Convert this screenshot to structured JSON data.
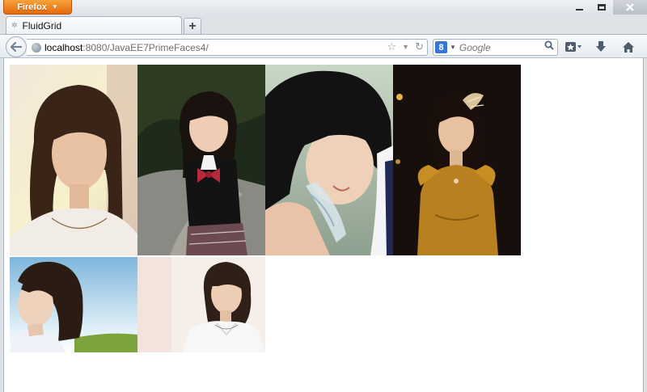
{
  "browser": {
    "menu_label": "Firefox",
    "menu_caret": "▼"
  },
  "tab": {
    "title": "FluidGrid",
    "new_tab_label": "+"
  },
  "address": {
    "host": "localhost",
    "path": ":8080/JavaEE7PrimeFaces4/"
  },
  "search": {
    "engine": "8",
    "placeholder": "Google"
  },
  "icons": {
    "back": "back-arrow-icon",
    "site": "globe-icon",
    "bookmark_star": "star-icon",
    "dropdown": "chevron-down-icon",
    "reload": "reload-icon",
    "search_go": "magnifier-icon",
    "bookmarks_menu": "bookmarks-icon",
    "downloads": "download-arrow-icon",
    "home": "home-icon"
  },
  "colors": {
    "firefox_button": "#e66a0c",
    "page_background": "#ffffff"
  },
  "gallery": {
    "images": [
      {
        "name": "woman-portrait-light-background"
      },
      {
        "name": "girl-school-uniform-red-bow"
      },
      {
        "name": "girl-smiling-drinking-water"
      },
      {
        "name": "woman-golden-dress-dark-background"
      },
      {
        "name": "woman-profile-sky-field"
      },
      {
        "name": "woman-short-hair-white-shirt"
      }
    ]
  }
}
